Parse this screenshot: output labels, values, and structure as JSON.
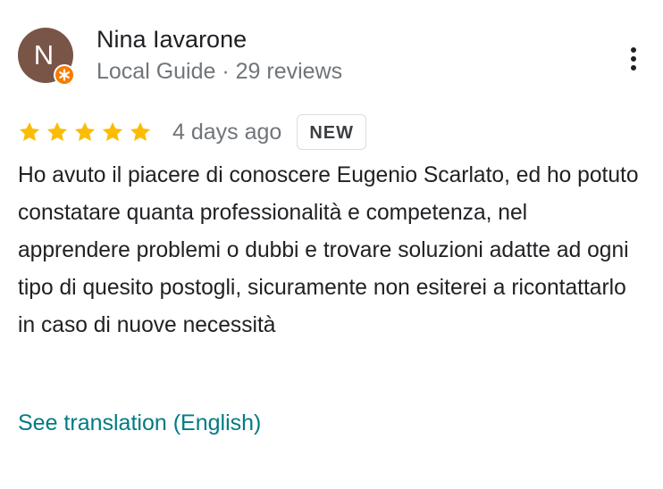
{
  "reviewer": {
    "avatar_initial": "N",
    "avatar_color": "#795548",
    "badge_color": "#f57c00",
    "name": "Nina Iavarone",
    "subtitle": "Local Guide · 29 reviews"
  },
  "menu": {
    "icon": "more-vert-icon"
  },
  "rating": {
    "stars": 5,
    "max_stars": 5,
    "star_color": "#fbbc04",
    "date": "4 days ago",
    "badge": "NEW"
  },
  "review": {
    "text": "Ho avuto il piacere di conoscere Eugenio Scarlato, ed ho potuto constatare quanta professionalità e competenza, nel apprendere problemi o dubbi e trovare soluzioni adatte ad ogni tipo di quesito postogli, sicuramente non esiterei a ricontattarlo in caso di nuove necessità"
  },
  "actions": {
    "translate_label": "See translation (English)",
    "link_color": "#007b83"
  }
}
